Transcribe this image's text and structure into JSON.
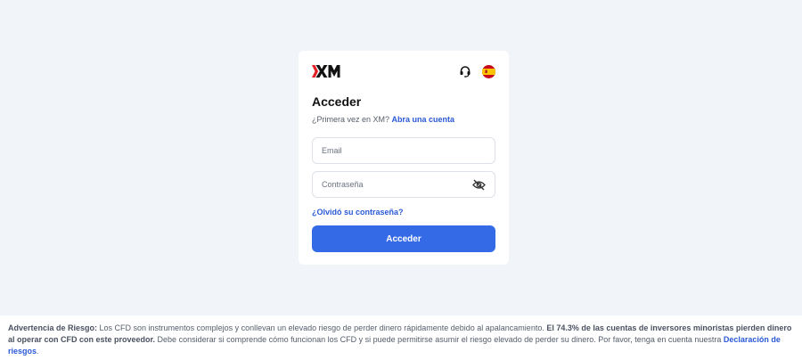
{
  "brand": {
    "logo_text": "XM",
    "accent_color": "#e31e24",
    "link_color": "#2a59d6",
    "button_color": "#346ae6"
  },
  "header": {
    "support_icon": "headset-icon",
    "language_icon": "spain-flag-icon"
  },
  "login": {
    "title": "Acceder",
    "first_time_text": "¿Primera vez en XM?",
    "signup_link": "Abra una cuenta",
    "email_placeholder": "Email",
    "email_value": "",
    "password_placeholder": "Contraseña",
    "password_value": "",
    "password_toggle_icon": "eye-off-icon",
    "forgot_link": "¿Olvidó su contraseña?",
    "submit_label": "Acceder"
  },
  "footer": {
    "risk_label": "Advertencia de Riesgo:",
    "risk_text_1": " Los CFD son instrumentos complejos y conllevan un elevado riesgo de perder dinero rápidamente debido al apalancamiento. ",
    "risk_bold": "El 74.3% de las cuentas de inversores minoristas pierden dinero al operar con CFD con este proveedor.",
    "risk_text_2": " Debe considerar si comprende cómo funcionan los CFD y si puede permitirse asumir el riesgo elevado de perder su dinero. Por favor, tenga en cuenta nuestra ",
    "risk_link": "Declaración de riesgos",
    "risk_end": "."
  }
}
